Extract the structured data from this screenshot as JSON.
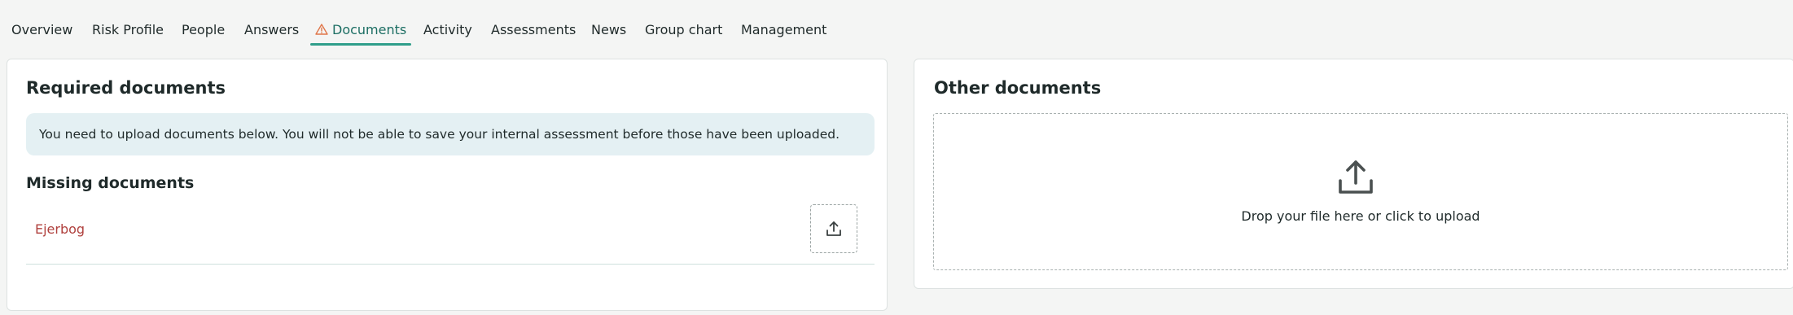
{
  "tabs": [
    {
      "label": "Overview"
    },
    {
      "label": "Risk Profile"
    },
    {
      "label": "People"
    },
    {
      "label": "Answers"
    },
    {
      "label": "Documents",
      "active": true,
      "icon": "warning-icon"
    },
    {
      "label": "Activity"
    },
    {
      "label": "Assessments"
    },
    {
      "label": "News"
    },
    {
      "label": "Group chart"
    },
    {
      "label": "Management"
    }
  ],
  "required": {
    "title": "Required documents",
    "notice": "You need to upload documents below. You will not be able to save your internal assessment before those have been uploaded.",
    "missing_title": "Missing documents",
    "missing": [
      {
        "name": "Ejerbog",
        "action_icon": "upload-icon"
      }
    ]
  },
  "other": {
    "title": "Other documents",
    "dropzone_text": "Drop your file here or click to upload",
    "dropzone_icon": "upload-icon"
  },
  "colors": {
    "accent": "#2f9e8a",
    "active_tab_text": "#1c6e63",
    "missing_link": "#b0413e",
    "notice_bg": "#e4f0f3",
    "warning": "#e0774a"
  }
}
